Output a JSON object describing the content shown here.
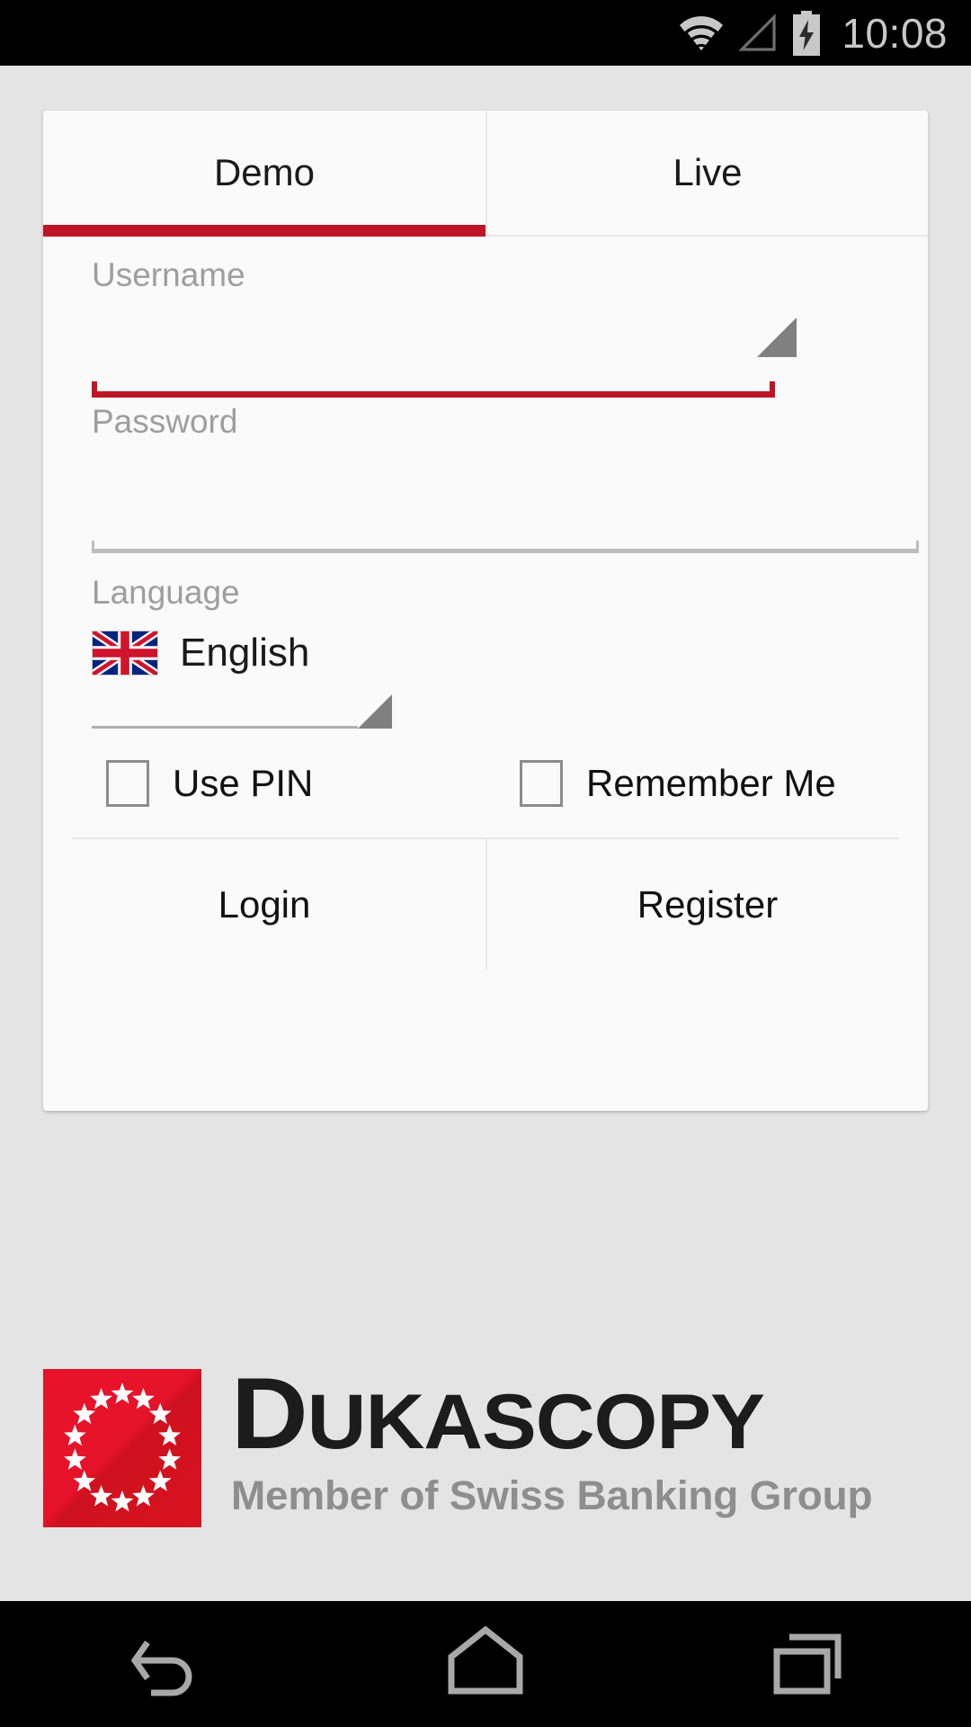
{
  "status_bar": {
    "clock": "10:08",
    "icons": [
      "wifi-icon",
      "cellular-signal-icon",
      "battery-charging-icon"
    ],
    "background": "#000000",
    "foreground": "#c8c8c8"
  },
  "theme": {
    "accent_red": "#be1526",
    "page_background": "#e4e4e4",
    "card_background": "#fafafa",
    "hint_gray": "#9e9e9e"
  },
  "login_card": {
    "tabs": [
      {
        "label": "Demo",
        "active": true
      },
      {
        "label": "Live",
        "active": false
      }
    ],
    "fields": {
      "username": {
        "label": "Username",
        "value": "",
        "placeholder": "Username",
        "focused": true,
        "has_dropdown": true
      },
      "password": {
        "label": "Password",
        "value": "",
        "placeholder": "Password",
        "focused": false,
        "has_dropdown": false
      },
      "language": {
        "label": "Language",
        "value": "English",
        "flag": "united-kingdom-flag",
        "has_dropdown": true
      }
    },
    "checkboxes": [
      {
        "label": "Use PIN",
        "checked": false
      },
      {
        "label": "Remember Me",
        "checked": false
      }
    ],
    "actions": [
      {
        "label": "Login"
      },
      {
        "label": "Register"
      }
    ]
  },
  "branding": {
    "wordmark_lead": "D",
    "wordmark_rest": "UKASCOPY",
    "tagline": "Member of Swiss Banking Group",
    "emblem": "red-square-star-circle-logo",
    "emblem_color": "#e2132a",
    "star_count": 14
  },
  "nav_bar": {
    "buttons": [
      {
        "name": "back-icon",
        "label": "Back"
      },
      {
        "name": "home-icon",
        "label": "Home"
      },
      {
        "name": "recents-icon",
        "label": "Recents"
      }
    ]
  }
}
